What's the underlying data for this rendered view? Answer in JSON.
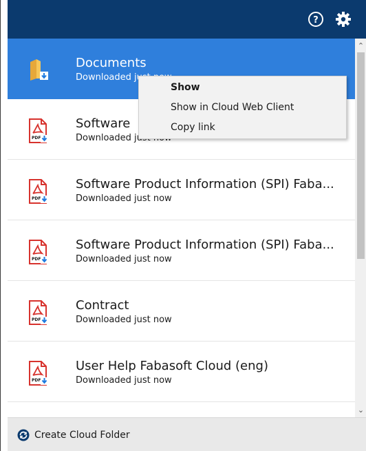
{
  "header": {
    "help_icon": "help-circle-icon",
    "settings_icon": "gear-icon",
    "background": "#0b3a6e"
  },
  "items": [
    {
      "title": "Documents",
      "status": "Downloaded just now",
      "icon": "folder-download-icon",
      "selected": true
    },
    {
      "title": "Software",
      "status": "Downloaded just now",
      "icon": "pdf-download-icon",
      "selected": false
    },
    {
      "title": "Software Product Information (SPI) Faba...",
      "status": "Downloaded just now",
      "icon": "pdf-download-icon",
      "selected": false
    },
    {
      "title": "Software Product Information (SPI) Faba...",
      "status": "Downloaded just now",
      "icon": "pdf-download-icon",
      "selected": false
    },
    {
      "title": "Contract",
      "status": "Downloaded just now",
      "icon": "pdf-download-icon",
      "selected": false
    },
    {
      "title": "User Help Fabasoft Cloud (eng)",
      "status": "Downloaded just now",
      "icon": "pdf-download-icon",
      "selected": false
    }
  ],
  "context_menu": {
    "items": [
      {
        "label": "Show"
      },
      {
        "label": "Show in Cloud Web Client"
      },
      {
        "label": "Copy link"
      }
    ]
  },
  "footer": {
    "create_label": "Create Cloud Folder",
    "create_icon": "add-circle-icon"
  },
  "colors": {
    "selected": "#2f7fdc",
    "pdf_red": "#d7322d",
    "download_blue": "#1e7be0"
  }
}
